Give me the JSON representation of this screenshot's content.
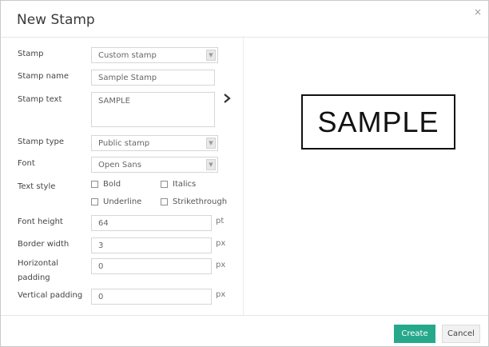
{
  "dialog": {
    "title": "New Stamp",
    "close_icon": "×"
  },
  "form": {
    "stamp": {
      "label": "Stamp",
      "value": "Custom stamp"
    },
    "stamp_name": {
      "label": "Stamp name",
      "value": "Sample Stamp"
    },
    "stamp_text": {
      "label": "Stamp text",
      "value": "SAMPLE"
    },
    "stamp_type": {
      "label": "Stamp type",
      "value": "Public stamp"
    },
    "font": {
      "label": "Font",
      "value": "Open Sans"
    },
    "text_style": {
      "label": "Text style",
      "bold": "Bold",
      "italics": "Italics",
      "underline": "Underline",
      "strikethrough": "Strikethrough"
    },
    "font_height": {
      "label": "Font height",
      "value": "64",
      "unit": "pt"
    },
    "border_width": {
      "label": "Border width",
      "value": "3",
      "unit": "px"
    },
    "horizontal_padding": {
      "label_line1": "Horizontal",
      "label_line2": "padding",
      "value": "0",
      "unit": "px"
    },
    "vertical_padding": {
      "label": "Vertical padding",
      "value": "0",
      "unit": "px"
    }
  },
  "preview": {
    "text": "SAMPLE"
  },
  "footer": {
    "create_label": "Create",
    "cancel_label": "Cancel"
  },
  "colors": {
    "accent": "#26a98a"
  },
  "icons": {
    "arrow": "chevron-right-icon",
    "dropdown": "caret-down-icon",
    "close": "close-icon"
  }
}
